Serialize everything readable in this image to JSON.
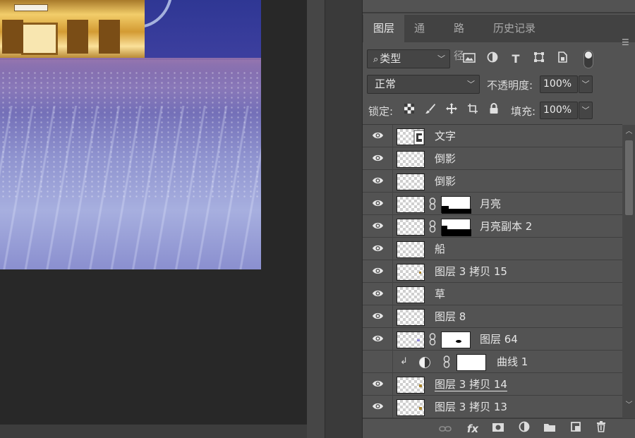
{
  "tabs": [
    "图层",
    "通道",
    "路径",
    "历史记录"
  ],
  "active_tab": "图层",
  "filter": {
    "label": "类型",
    "search_glyph": "⌕"
  },
  "filter_icons": [
    "image-filter-icon",
    "adjustment-filter-icon",
    "type-filter-icon",
    "shape-filter-icon",
    "smart-object-filter-icon"
  ],
  "blend_mode": "正常",
  "opacity": {
    "label": "不透明度:",
    "value": "100%"
  },
  "lock": {
    "label": "锁定:"
  },
  "fill": {
    "label": "填充:",
    "value": "100%"
  },
  "layers": [
    {
      "name": "文字",
      "visible": true,
      "mask": false,
      "kind": "group"
    },
    {
      "name": "倒影",
      "visible": true,
      "mask": false,
      "kind": "pixel"
    },
    {
      "name": "倒影",
      "visible": true,
      "mask": false,
      "kind": "pixel"
    },
    {
      "name": "月亮",
      "visible": true,
      "mask": true,
      "kind": "pixel"
    },
    {
      "name": "月亮副本 2",
      "visible": true,
      "mask": true,
      "kind": "pixel"
    },
    {
      "name": "船",
      "visible": true,
      "mask": false,
      "kind": "pixel"
    },
    {
      "name": "图层 3 拷贝 15",
      "visible": true,
      "mask": false,
      "kind": "pixel"
    },
    {
      "name": "草",
      "visible": true,
      "mask": false,
      "kind": "pixel"
    },
    {
      "name": "图层 8",
      "visible": true,
      "mask": false,
      "kind": "pixel"
    },
    {
      "name": "图层 64",
      "visible": true,
      "mask": true,
      "kind": "pixel"
    },
    {
      "name": "曲线 1",
      "visible": false,
      "mask": true,
      "kind": "adjustment",
      "clipped": true
    },
    {
      "name": "图层 3 拷贝 14",
      "visible": true,
      "mask": false,
      "kind": "pixel"
    },
    {
      "name": "图层 3 拷贝 13",
      "visible": true,
      "mask": false,
      "kind": "pixel"
    }
  ],
  "footer_icons": [
    "link-layers-icon",
    "fx-icon",
    "add-mask-icon",
    "new-adjustment-icon",
    "new-group-icon",
    "new-layer-icon",
    "delete-layer-icon"
  ],
  "footer_fx_label": "fx",
  "colors": {
    "panel": "#535353",
    "tabbar": "#424242",
    "text": "#e6e6e6",
    "canvas_bg": "#282828"
  }
}
